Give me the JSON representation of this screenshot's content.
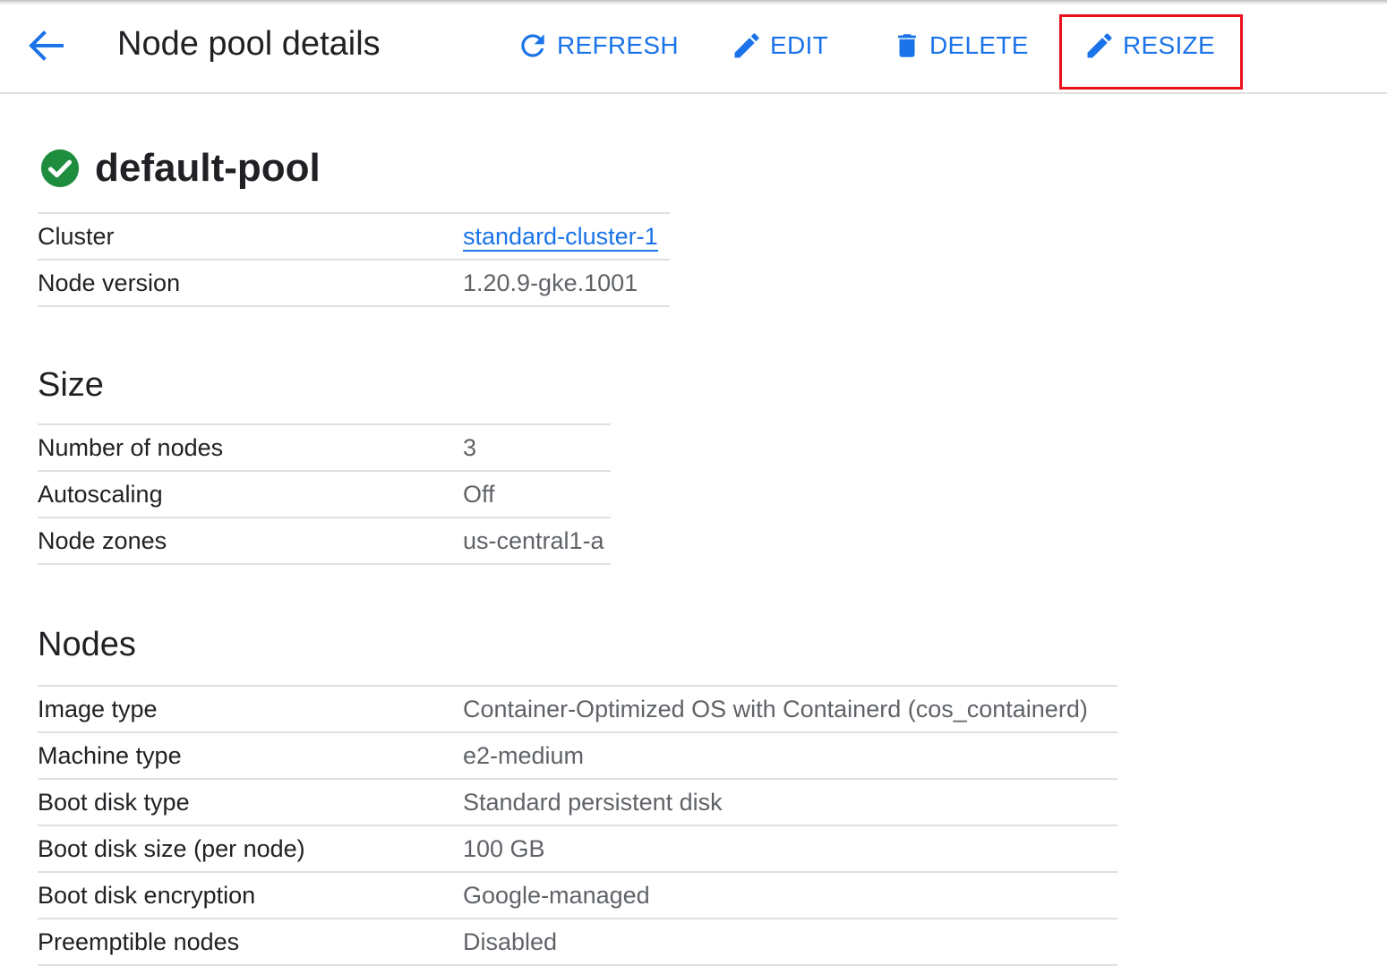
{
  "header": {
    "title": "Node pool details",
    "actions": {
      "refresh": "REFRESH",
      "edit": "EDIT",
      "delete": "DELETE",
      "resize": "RESIZE"
    },
    "accent_color": "#1a73e8",
    "highlight_color": "#e8101b"
  },
  "pool": {
    "name": "default-pool",
    "status_icon": "check-circle-icon",
    "status_color": "#1e8e3e",
    "details": {
      "cluster_label": "Cluster",
      "cluster_value": "standard-cluster-1",
      "node_version_label": "Node version",
      "node_version_value": "1.20.9-gke.1001"
    }
  },
  "size": {
    "heading": "Size",
    "rows": [
      {
        "label": "Number of nodes",
        "value": "3"
      },
      {
        "label": "Autoscaling",
        "value": "Off"
      },
      {
        "label": "Node zones",
        "value": "us-central1-a"
      }
    ]
  },
  "nodes": {
    "heading": "Nodes",
    "rows": [
      {
        "label": "Image type",
        "value": "Container-Optimized OS with Containerd (cos_containerd)"
      },
      {
        "label": "Machine type",
        "value": "e2-medium"
      },
      {
        "label": "Boot disk type",
        "value": "Standard persistent disk"
      },
      {
        "label": "Boot disk size (per node)",
        "value": "100 GB"
      },
      {
        "label": "Boot disk encryption",
        "value": "Google-managed"
      },
      {
        "label": "Preemptible nodes",
        "value": "Disabled"
      }
    ]
  }
}
